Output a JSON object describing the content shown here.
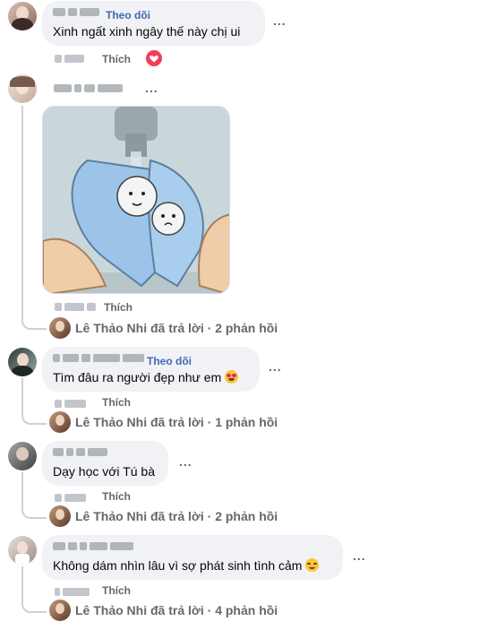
{
  "comments": [
    {
      "follow_label": "Theo dõi",
      "text": "Xinh ngất xinh ngây thế này chị ui",
      "like_label": "Thích",
      "reaction_icon": "heart-icon",
      "reaction_color": "#f33e58"
    },
    {
      "text": "",
      "image_desc": "sticker-image",
      "like_label": "Thích",
      "reply_summary": "Lê Thảo Nhi đã trả lời · 2 phản hồi"
    },
    {
      "follow_label": "Theo dõi",
      "text": "Tìm đâu ra người đẹp như em",
      "emoji": "heart-eyes-emoji",
      "like_label": "Thích",
      "reply_summary": "Lê Thảo Nhi đã trả lời · 1 phản hồi"
    },
    {
      "text": "Dạy học với Tú bà",
      "like_label": "Thích",
      "reply_summary": "Lê Thảo Nhi đã trả lời · 2 phản hồi"
    },
    {
      "text": "Không dám nhìn lâu vì sợ phát sinh tình cảm",
      "emoji": "relieved-emoji",
      "like_label": "Thích",
      "reply_summary": "Lê Thảo Nhi đã trả lời · 4 phản hồi"
    }
  ],
  "more_options_label": "...",
  "colors": {
    "bubble": "#f0f2f5",
    "follow": "#4267b2",
    "meta": "#65676b",
    "thread": "#ced0d4"
  }
}
